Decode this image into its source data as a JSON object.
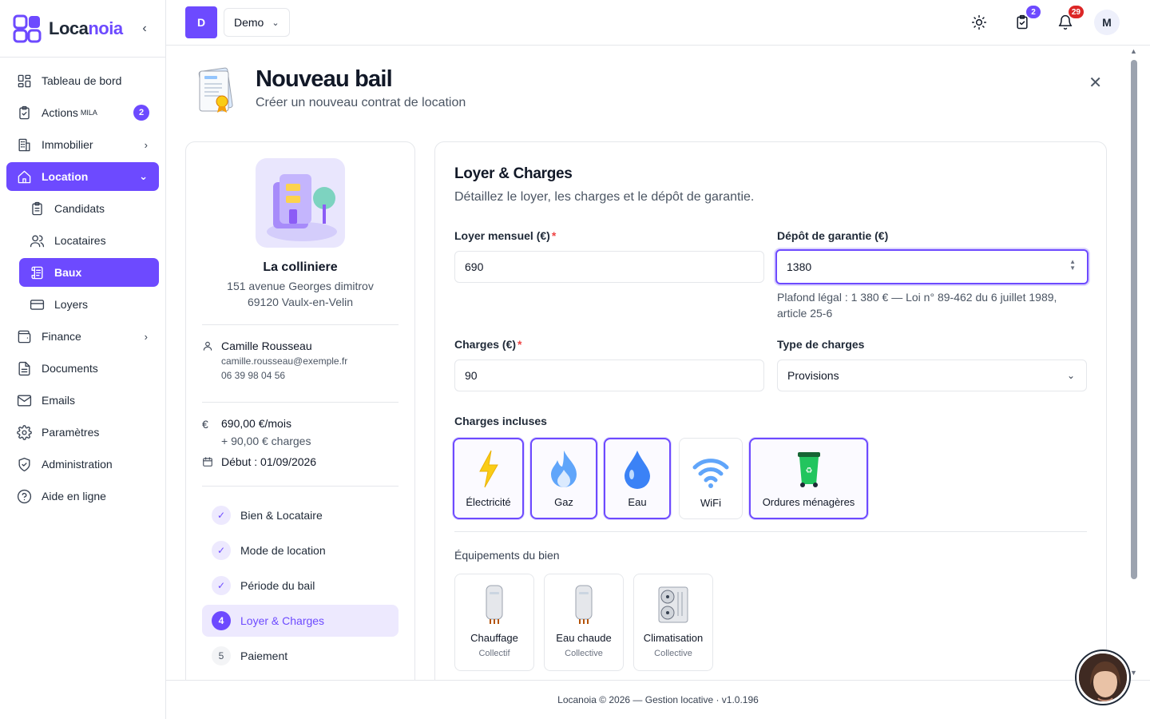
{
  "app": {
    "brand_main": "Loca",
    "brand_accent": "noia"
  },
  "sidebar": {
    "collapse_icon": "chevron-left-icon",
    "items": [
      {
        "label": "Tableau de bord",
        "icon": "dashboard-icon"
      },
      {
        "label": "Actions",
        "sup": "MILA",
        "badge": "2",
        "icon": "clipboard-check-icon"
      },
      {
        "label": "Immobilier",
        "icon": "building-icon"
      },
      {
        "label": "Location",
        "icon": "home-icon"
      },
      {
        "label": "Candidats",
        "icon": "clipboard-list-icon"
      },
      {
        "label": "Locataires",
        "icon": "users-icon"
      },
      {
        "label": "Baux",
        "icon": "scroll-icon"
      },
      {
        "label": "Loyers",
        "icon": "credit-card-icon"
      },
      {
        "label": "Finance",
        "icon": "wallet-icon"
      },
      {
        "label": "Documents",
        "icon": "document-icon"
      },
      {
        "label": "Emails",
        "icon": "mail-icon"
      },
      {
        "label": "Paramètres",
        "icon": "gear-icon"
      },
      {
        "label": "Administration",
        "icon": "shield-check-icon"
      },
      {
        "label": "Aide en ligne",
        "icon": "help-circle-icon"
      }
    ]
  },
  "topbar": {
    "org_initial": "D",
    "org_name": "Demo",
    "tasks_badge": "2",
    "notif_badge": "29",
    "user_initial": "M"
  },
  "page": {
    "title": "Nouveau bail",
    "subtitle": "Créer un nouveau contrat de location"
  },
  "summary": {
    "property_name": "La colliniere",
    "address_line1": "151 avenue Georges dimitrov",
    "address_line2": "69120 Vaulx-en-Velin",
    "tenant_name": "Camille Rousseau",
    "tenant_email": "camille.rousseau@exemple.fr",
    "tenant_phone": "06 39 98 04 56",
    "rent": "690,00 €/mois",
    "charges": "+ 90,00 € charges",
    "start": "Début : 01/09/2026"
  },
  "steps": [
    {
      "label": "Bien & Locataire",
      "marker": "✓"
    },
    {
      "label": "Mode de location",
      "marker": "✓"
    },
    {
      "label": "Période du bail",
      "marker": "✓"
    },
    {
      "label": "Loyer & Charges",
      "marker": "4"
    },
    {
      "label": "Paiement",
      "marker": "5"
    }
  ],
  "form": {
    "title": "Loyer & Charges",
    "subtitle": "Détaillez le loyer, les charges et le dépôt de garantie.",
    "rent_label": "Loyer mensuel (€)",
    "rent_value": "690",
    "deposit_label": "Dépôt de garantie (€)",
    "deposit_value": "1380",
    "deposit_hint_1": "Plafond légal : 1 380 € — Loi n° 89-462 du 6 juillet 1989,",
    "deposit_hint_2": "article 25-6",
    "charges_label": "Charges (€)",
    "charges_value": "90",
    "charges_type_label": "Type de charges",
    "charges_type_value": "Provisions",
    "required_mark": "*",
    "included_label": "Charges incluses",
    "included": [
      {
        "label": "Électricité",
        "selected": true,
        "icon": "lightning-icon"
      },
      {
        "label": "Gaz",
        "selected": true,
        "icon": "flame-icon"
      },
      {
        "label": "Eau",
        "selected": true,
        "icon": "water-drop-icon"
      },
      {
        "label": "WiFi",
        "selected": false,
        "icon": "wifi-icon"
      },
      {
        "label": "Ordures ménagères",
        "selected": true,
        "icon": "trash-bin-icon"
      }
    ],
    "equipment_label": "Équipements du bien",
    "equipment": [
      {
        "label": "Chauffage",
        "sub": "Collectif",
        "icon": "boiler-icon"
      },
      {
        "label": "Eau chaude",
        "sub": "Collective",
        "icon": "water-heater-icon"
      },
      {
        "label": "Climatisation",
        "sub": "Collective",
        "icon": "air-conditioner-icon"
      }
    ]
  },
  "footer": {
    "text": "Locanoia © 2026 — Gestion locative · v1.0.196"
  },
  "colors": {
    "accent": "#6d4aff",
    "danger_badge": "#ef4444",
    "selected_border": "#6d4aff"
  }
}
